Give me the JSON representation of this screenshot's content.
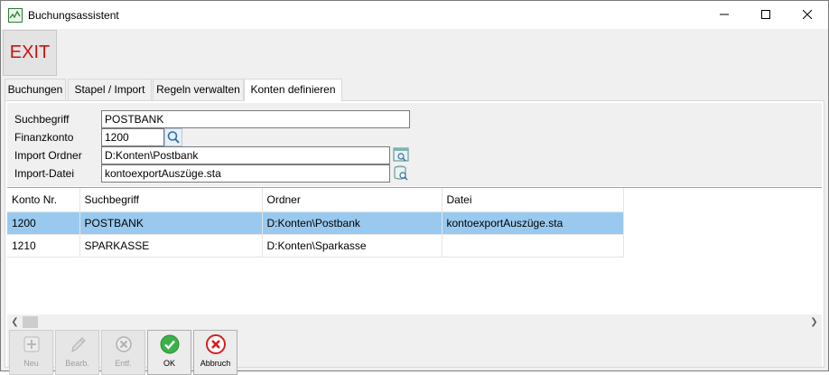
{
  "window": {
    "title": "Buchungsassistent",
    "icons": {
      "app": "app-chart-icon",
      "minimize": "minimize-icon",
      "maximize": "maximize-icon",
      "close": "close-icon"
    }
  },
  "toolbar": {
    "exit_label": "EXIT"
  },
  "tabs": [
    {
      "label": "Buchungen",
      "active": false
    },
    {
      "label": "Stapel / Import",
      "active": false
    },
    {
      "label": "Regeln verwalten",
      "active": false
    },
    {
      "label": "Konten definieren",
      "active": true
    }
  ],
  "form": {
    "suchbegriff": {
      "label": "Suchbegriff",
      "value": "POSTBANK"
    },
    "finanzkonto": {
      "label": "Finanzkonto",
      "value": "1200"
    },
    "import_ordner": {
      "label": "Import Ordner",
      "value": "D:Konten\\Postbank"
    },
    "import_datei": {
      "label": "Import-Datei",
      "value": "kontoexportAuszüge.sta"
    }
  },
  "table": {
    "columns": [
      "Konto Nr.",
      "Suchbegriff",
      "Ordner",
      "Datei"
    ],
    "rows": [
      {
        "konto": "1200",
        "suchbegriff": "POSTBANK",
        "ordner": "D:Konten\\Postbank",
        "datei": "kontoexportAuszüge.sta",
        "selected": true
      },
      {
        "konto": "1210",
        "suchbegriff": "SPARKASSE",
        "ordner": "D:Konten\\Sparkasse",
        "datei": "",
        "selected": false
      }
    ],
    "selection_color": "#99c9ef"
  },
  "buttons": {
    "neu": {
      "label": "Neu",
      "enabled": false,
      "icon": "add-icon"
    },
    "bearb": {
      "label": "Bearb.",
      "enabled": false,
      "icon": "pencil-icon"
    },
    "entf": {
      "label": "Entf.",
      "enabled": false,
      "icon": "delete-icon"
    },
    "ok": {
      "label": "OK",
      "enabled": true,
      "icon": "check-icon",
      "color": "#2e9e2e"
    },
    "abbruch": {
      "label": "Abbruch",
      "enabled": true,
      "icon": "cancel-icon",
      "color": "#d32020"
    }
  },
  "colors": {
    "exit_text": "#cc1111"
  }
}
